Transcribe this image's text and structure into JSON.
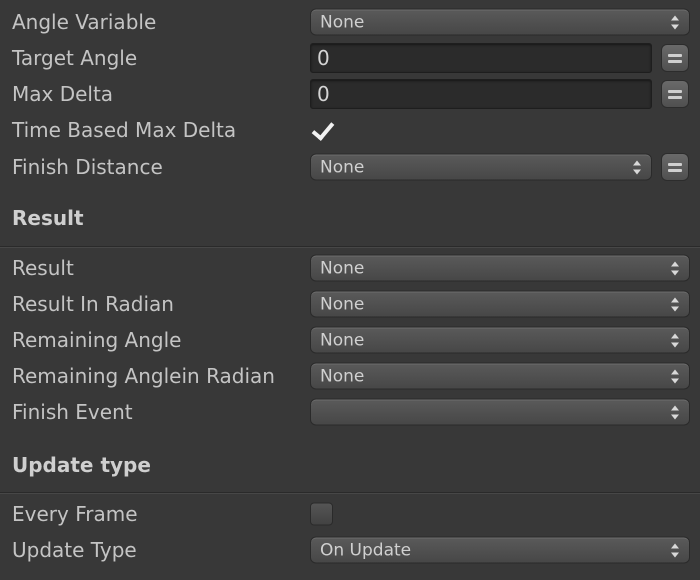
{
  "fields": {
    "angle_variable": {
      "label": "Angle Variable",
      "value": "None"
    },
    "target_angle": {
      "label": "Target Angle",
      "value": "0"
    },
    "max_delta": {
      "label": "Max Delta",
      "value": "0"
    },
    "time_based_max_delta": {
      "label": "Time Based Max Delta",
      "checked": true
    },
    "finish_distance": {
      "label": "Finish Distance",
      "value": "None"
    }
  },
  "result_section": {
    "title": "Result",
    "result": {
      "label": "Result",
      "value": "None"
    },
    "result_in_radian": {
      "label": "Result In Radian",
      "value": "None"
    },
    "remaining_angle": {
      "label": "Remaining Angle",
      "value": "None"
    },
    "remaining_angle_in_radian": {
      "label": "Remaining Anglein Radian",
      "value": "None"
    },
    "finish_event": {
      "label": "Finish Event",
      "value": ""
    }
  },
  "update_section": {
    "title": "Update type",
    "every_frame": {
      "label": "Every Frame",
      "checked": false
    },
    "update_type": {
      "label": "Update Type",
      "value": "On Update"
    }
  },
  "icons": {
    "dropdown_arrows": "updown-arrows-icon",
    "variable_toggle": "equals-icon",
    "check": "checkmark-icon"
  }
}
